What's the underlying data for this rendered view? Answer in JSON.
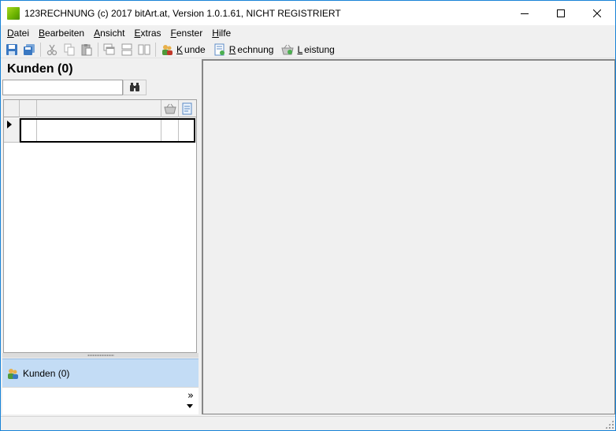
{
  "window": {
    "title": "123RECHNUNG (c) 2017 bitArt.at, Version 1.0.1.61, NICHT REGISTRIERT"
  },
  "menu": {
    "items": [
      {
        "first": "D",
        "rest": "atei"
      },
      {
        "first": "B",
        "rest": "earbeiten"
      },
      {
        "first": "A",
        "rest": "nsicht"
      },
      {
        "first": "E",
        "rest": "xtras"
      },
      {
        "first": "F",
        "rest": "enster"
      },
      {
        "first": "H",
        "rest": "ilfe"
      }
    ]
  },
  "toolbar": {
    "kunde": {
      "first": "K",
      "rest": "unde"
    },
    "rechnung": {
      "first": "R",
      "rest": "echnung"
    },
    "leistung": {
      "first": "L",
      "rest": "eistung"
    }
  },
  "left_panel": {
    "title": "Kunden (0)",
    "search": {
      "value": "",
      "placeholder": ""
    },
    "nav_item": "Kunden (0)",
    "chevron": "»"
  },
  "colors": {
    "accent": "#1883d7",
    "nav_selected": "#c3dcf5",
    "window_bg": "#f0f0f0"
  }
}
